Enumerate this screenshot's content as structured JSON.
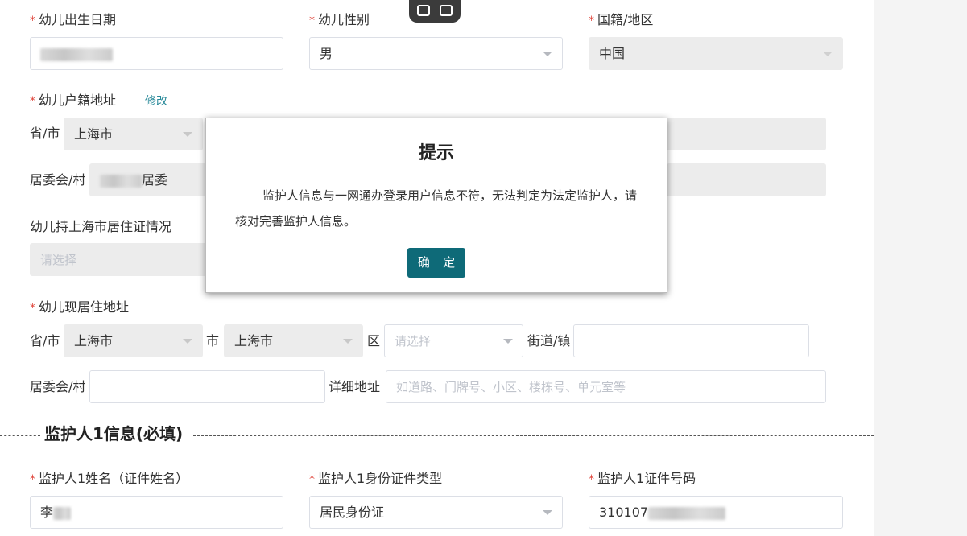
{
  "child": {
    "birthdate_label": "幼儿出生日期",
    "gender_label": "幼儿性别",
    "gender_value": "男",
    "nationality_label": "国籍/地区",
    "nationality_value": "中国",
    "hukou_label": "幼儿户籍地址",
    "modify_link": "修改",
    "hukou_province_label": "省/市",
    "hukou_province_value": "上海市",
    "hukou_committee_label": "居委会/村",
    "hukou_committee_value": "居委",
    "residence_permit_label": "幼儿持上海市居住证情况",
    "residence_permit_placeholder": "请选择",
    "current_address_label": "幼儿现居住地址",
    "current_province_label": "省/市",
    "current_province_value": "上海市",
    "current_city_label": "市",
    "current_city_value": "上海市",
    "current_district_label": "区",
    "current_district_placeholder": "请选择",
    "current_street_label": "街道/镇",
    "current_committee_label": "居委会/村",
    "current_detail_label": "详细地址",
    "current_detail_placeholder": "如道路、门牌号、小区、楼栋号、单元室等"
  },
  "guardian_section": {
    "title": "监护人1信息(必填)",
    "name_label": "监护人1姓名（证件姓名）",
    "name_value": "李",
    "id_type_label": "监护人1身份证件类型",
    "id_type_value": "居民身份证",
    "id_number_label": "监护人1证件号码",
    "id_number_value": "310107"
  },
  "modal": {
    "title": "提示",
    "message": "监护人信息与一网通办登录用户信息不符，无法判定为法定监护人，请核对完善监护人信息。",
    "confirm_label": "确 定"
  },
  "required_mark": "*"
}
